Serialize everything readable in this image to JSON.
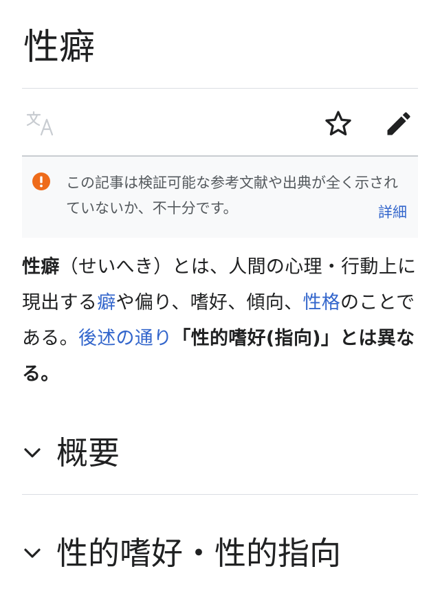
{
  "page": {
    "title": "性癖"
  },
  "toolbar": {
    "language_icon": "translate-icon",
    "watch_icon": "star-outline-icon",
    "edit_icon": "pencil-icon"
  },
  "notice": {
    "icon": "error-circle-icon",
    "icon_color": "#ee6b1a",
    "text": "この記事は検証可能な参考文献や出典が全く示されていないか、不十分です。",
    "more_label": "詳細"
  },
  "lead": {
    "term": "性癖",
    "t1": "（せいへき）とは、人間の心理・行動上に現出する",
    "link1": "癖",
    "t2": "や偏り、嗜好、傾向、",
    "link2": "性格",
    "t3": "のことである。",
    "link3": "後述の通り",
    "emphasis": "「性的嗜好(指向)」とは異なる。"
  },
  "sections": [
    {
      "title": "概要"
    },
    {
      "title": "性的嗜好・性的指向"
    }
  ],
  "colors": {
    "link": "#3366cc",
    "text": "#202122"
  }
}
